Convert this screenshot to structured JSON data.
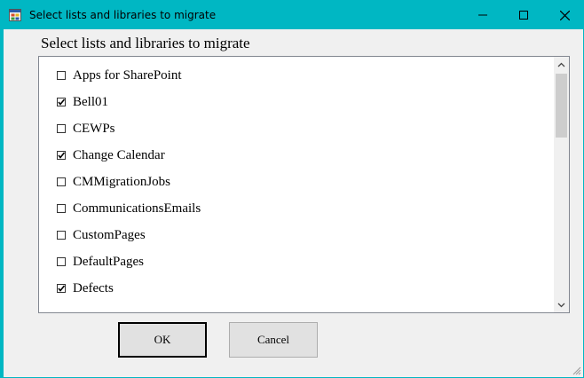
{
  "window": {
    "title": "Select lists and libraries to migrate",
    "accent_color": "#00b7c3"
  },
  "header": {
    "label": "Select lists and libraries to migrate"
  },
  "list": {
    "items": [
      {
        "label": "Apps for SharePoint",
        "checked": false
      },
      {
        "label": "Bell01",
        "checked": true
      },
      {
        "label": "CEWPs",
        "checked": false
      },
      {
        "label": "Change Calendar",
        "checked": true
      },
      {
        "label": "CMMigrationJobs",
        "checked": false
      },
      {
        "label": "CommunicationsEmails",
        "checked": false
      },
      {
        "label": "CustomPages",
        "checked": false
      },
      {
        "label": "DefaultPages",
        "checked": false
      },
      {
        "label": "Defects",
        "checked": true
      }
    ]
  },
  "buttons": {
    "ok_label": "OK",
    "cancel_label": "Cancel"
  }
}
